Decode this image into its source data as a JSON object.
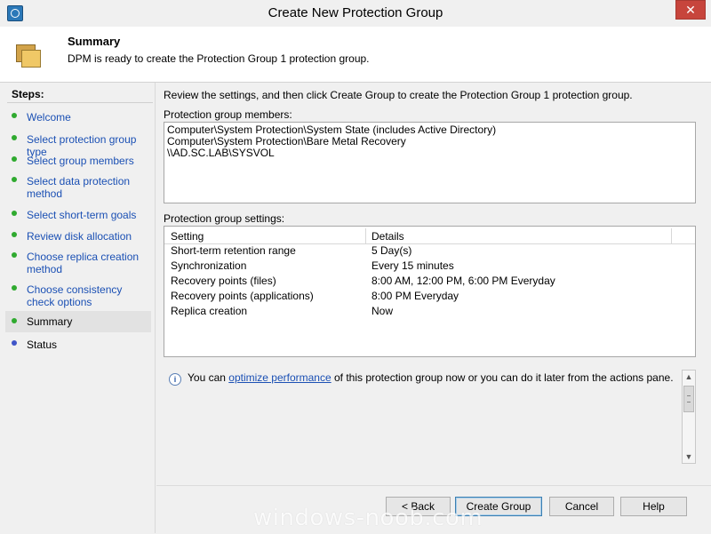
{
  "window": {
    "title": "Create New Protection Group",
    "close_label": "✕"
  },
  "header": {
    "title": "Summary",
    "subtitle": "DPM is ready to create the Protection Group 1 protection group."
  },
  "steps": {
    "heading": "Steps:",
    "items": [
      {
        "label": "Welcome",
        "state": "done"
      },
      {
        "label": "Select protection group type",
        "state": "done"
      },
      {
        "label": "Select group members",
        "state": "done"
      },
      {
        "label": "Select data protection method",
        "state": "done"
      },
      {
        "label": "Select short-term goals",
        "state": "done"
      },
      {
        "label": "Review disk allocation",
        "state": "done"
      },
      {
        "label": "Choose replica creation method",
        "state": "done"
      },
      {
        "label": "Choose consistency check options",
        "state": "done"
      },
      {
        "label": "Summary",
        "state": "current"
      },
      {
        "label": "Status",
        "state": "pending"
      }
    ]
  },
  "main": {
    "intro": "Review the settings, and then click Create Group to create the Protection Group 1 protection group.",
    "members_label": "Protection group members:",
    "members": [
      "Computer\\System Protection\\System State (includes Active Directory)",
      "Computer\\System Protection\\Bare Metal Recovery",
      "\\\\AD.SC.LAB\\SYSVOL"
    ],
    "settings_label": "Protection group settings:",
    "settings_table": {
      "headers": [
        "Setting",
        "Details"
      ],
      "rows": [
        [
          "Short-term retention range",
          "5 Day(s)"
        ],
        [
          "Synchronization",
          "Every 15 minutes"
        ],
        [
          "Recovery points (files)",
          "8:00 AM, 12:00 PM, 6:00 PM Everyday"
        ],
        [
          "Recovery points (applications)",
          "8:00 PM Everyday"
        ],
        [
          "Replica creation",
          "Now"
        ]
      ]
    },
    "info": {
      "prefix": "You can ",
      "link": "optimize performance",
      "suffix": " of this protection group now or you can do it later from the actions pane."
    }
  },
  "footer": {
    "back": "< Back",
    "create": "Create Group",
    "cancel": "Cancel",
    "help": "Help"
  },
  "watermark": "windows-noob.com",
  "colors": {
    "link": "#1b50b4",
    "step_done": "#2faa2f",
    "step_pending": "#3f55c8",
    "close": "#c7453c"
  }
}
